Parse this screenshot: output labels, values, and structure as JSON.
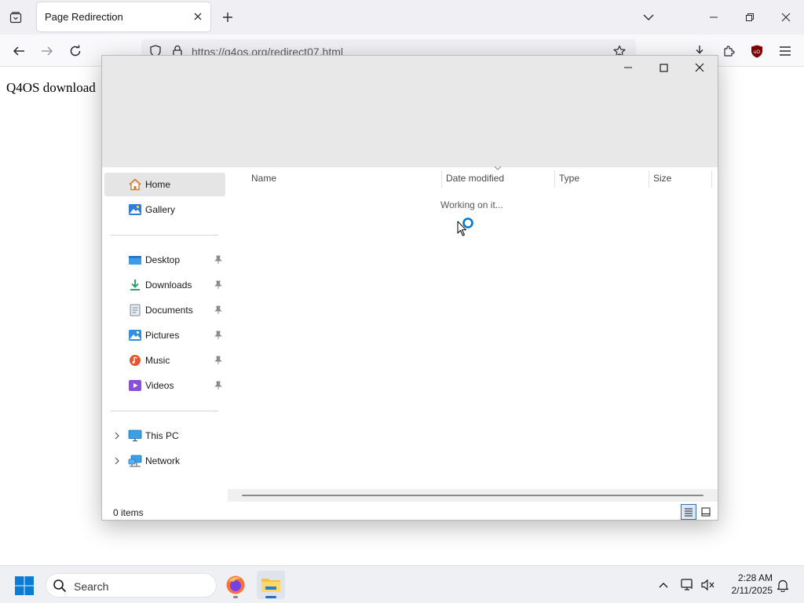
{
  "browser": {
    "tab_title": "Page Redirection",
    "url": "https://q4os.org/redirect07.html"
  },
  "page": {
    "text": "Q4OS download"
  },
  "dialog": {
    "sidebar": {
      "quick": [
        {
          "label": "Home",
          "icon": "home-icon",
          "selected": true
        },
        {
          "label": "Gallery",
          "icon": "gallery-icon"
        }
      ],
      "pinned": [
        {
          "label": "Desktop",
          "icon": "desktop-folder-icon"
        },
        {
          "label": "Downloads",
          "icon": "downloads-folder-icon"
        },
        {
          "label": "Documents",
          "icon": "documents-folder-icon"
        },
        {
          "label": "Pictures",
          "icon": "pictures-folder-icon"
        },
        {
          "label": "Music",
          "icon": "music-folder-icon"
        },
        {
          "label": "Videos",
          "icon": "videos-folder-icon"
        }
      ],
      "locations": [
        {
          "label": "This PC",
          "icon": "this-pc-icon"
        },
        {
          "label": "Network",
          "icon": "network-icon"
        }
      ]
    },
    "columns": [
      "Name",
      "Date modified",
      "Type",
      "Size"
    ],
    "loading_text": "Working on it...",
    "status": "0 items"
  },
  "taskbar": {
    "search_placeholder": "Search",
    "time": "2:28 AM",
    "date": "2/11/2025"
  },
  "colors": {
    "accent": "#0078d4",
    "browser_chrome": "#f0f0f4",
    "dialog_header": "#e8e8e8",
    "selection": "#e5e5e5",
    "ublock_red": "#800000"
  }
}
